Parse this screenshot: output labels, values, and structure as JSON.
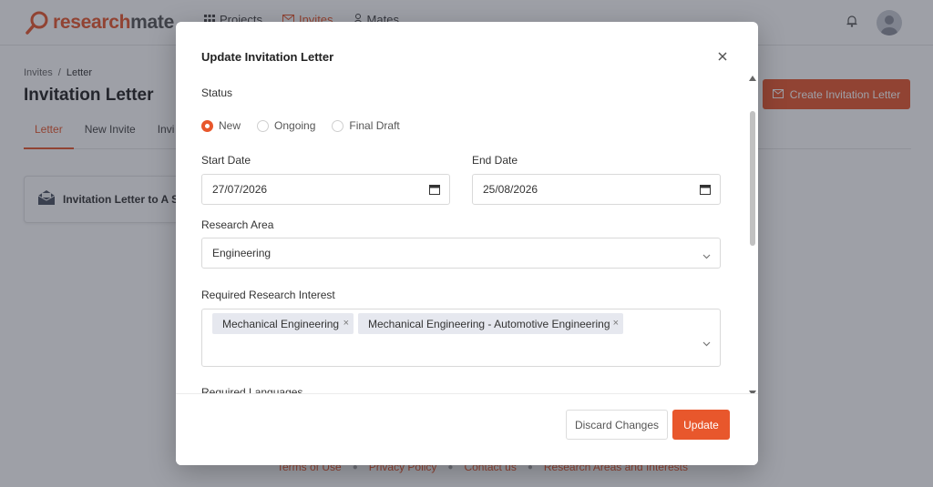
{
  "app": {
    "logo_part1": "research",
    "logo_part2": "mate",
    "nav": [
      {
        "label": "Projects"
      },
      {
        "label": "Invites"
      },
      {
        "label": "Mates"
      }
    ]
  },
  "breadcrumb": {
    "parent": "Invites",
    "separator": "/",
    "current": "Letter"
  },
  "page": {
    "title": "Invitation Letter",
    "create_button": "Create Invitation Letter",
    "tabs": [
      "Letter",
      "New Invite",
      "Invi"
    ],
    "card_text": "Invitation Letter to A St"
  },
  "footer": {
    "links": [
      "Terms of Use",
      "Privacy Policy",
      "Contact us",
      "Research Areas and Interests"
    ]
  },
  "modal": {
    "title": "Update Invitation Letter",
    "status_label": "Status",
    "status_options": [
      {
        "label": "New",
        "selected": true
      },
      {
        "label": "Ongoing",
        "selected": false
      },
      {
        "label": "Final Draft",
        "selected": false
      }
    ],
    "start_date_label": "Start Date",
    "start_date_value": "27/07/2026",
    "end_date_label": "End Date",
    "end_date_value": "25/08/2026",
    "research_area_label": "Research Area",
    "research_area_value": "Engineering",
    "interest_label": "Required Research Interest",
    "interest_tags": [
      "Mechanical Engineering",
      "Mechanical Engineering - Automotive Engineering"
    ],
    "tag_remove_glyph": "×",
    "languages_label": "Required Languages",
    "discard_button": "Discard Changes",
    "update_button": "Update"
  },
  "colors": {
    "accent": "#e8572c",
    "overlay": "rgba(40,44,60,0.45)"
  }
}
